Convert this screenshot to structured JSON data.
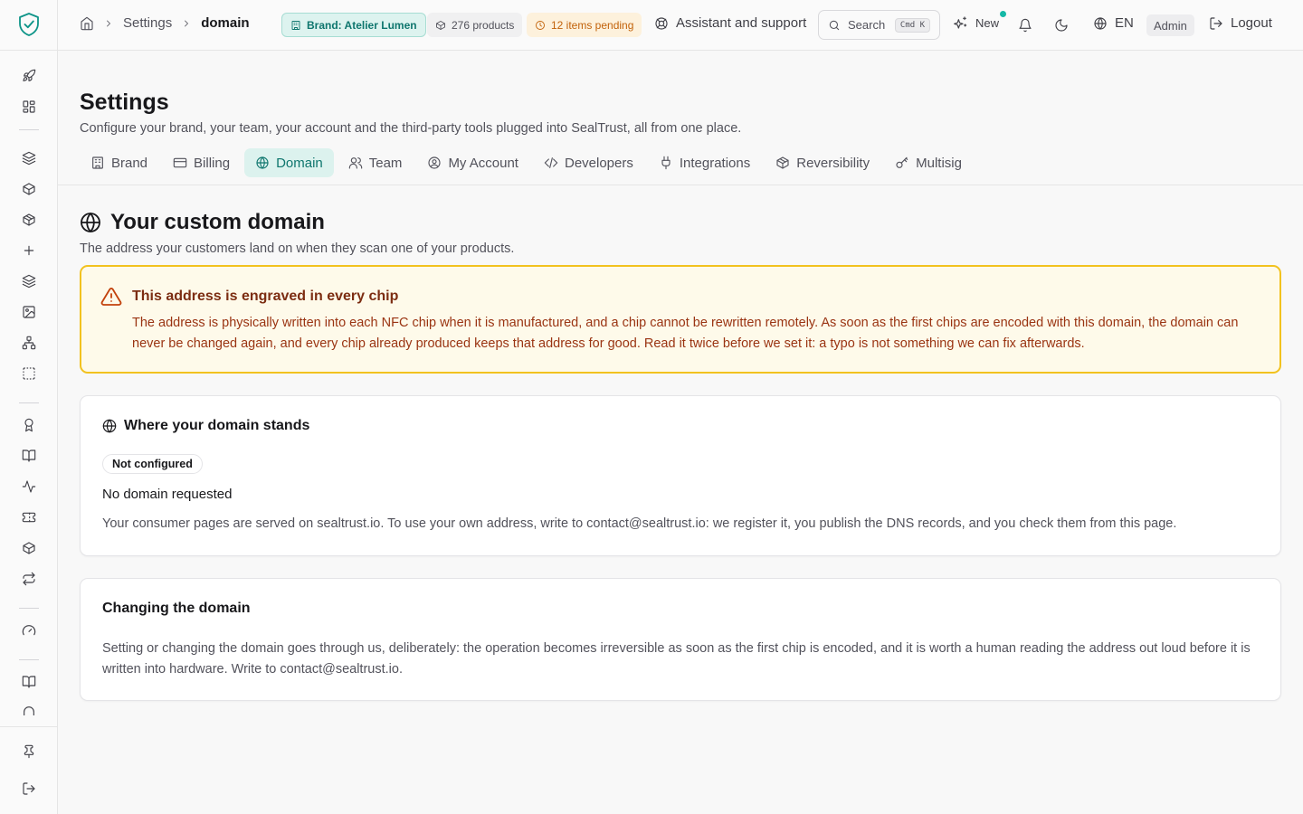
{
  "breadcrumb": {
    "parent": "Settings",
    "current": "domain"
  },
  "pills": {
    "brand": "Brand: Atelier Lumen",
    "products": "276 products",
    "pending": "12 items pending"
  },
  "topbar": {
    "assistant": "Assistant and support",
    "search_label": "Search",
    "search_shortcut": "Cmd  K",
    "new_label": "New",
    "language": "EN",
    "role": "Admin",
    "logout": "Logout"
  },
  "header": {
    "title": "Settings",
    "subtitle": "Configure your brand, your team, your account and the third-party tools plugged into SealTrust, all from one place."
  },
  "tabs": [
    {
      "label": "Brand",
      "icon": "building-icon"
    },
    {
      "label": "Billing",
      "icon": "credit-card-icon"
    },
    {
      "label": "Domain",
      "icon": "globe-icon",
      "active": true
    },
    {
      "label": "Team",
      "icon": "users-icon"
    },
    {
      "label": "My Account",
      "icon": "user-circle-icon"
    },
    {
      "label": "Developers",
      "icon": "code-icon"
    },
    {
      "label": "Integrations",
      "icon": "plug-icon"
    },
    {
      "label": "Reversibility",
      "icon": "package-icon"
    },
    {
      "label": "Multisig",
      "icon": "key-icon"
    }
  ],
  "section": {
    "title": "Your custom domain",
    "subtitle": "The address your customers land on when they scan one of your products."
  },
  "warning": {
    "title": "This address is engraved in every chip",
    "body": "The address is physically written into each NFC chip when it is manufactured, and a chip cannot be rewritten remotely. As soon as the first chips are encoded with this domain, the domain can never be changed again, and every chip already produced keeps that address for good. Read it twice before we set it: a typo is not something we can fix afterwards."
  },
  "status_card": {
    "title": "Where your domain stands",
    "badge": "Not configured",
    "headline": "No domain requested",
    "description": "Your consumer pages are served on sealtrust.io. To use your own address, write to contact@sealtrust.io: we register it, you publish the DNS records, and you check them from this page."
  },
  "change_card": {
    "title": "Changing the domain",
    "body": "Setting or changing the domain goes through us, deliberately: the operation becomes irreversible as soon as the first chip is encoded, and it is worth a human reading the address out loud before it is written into hardware. Write to contact@sealtrust.io."
  },
  "colors": {
    "accent": "#0f766e",
    "accent_bg": "#dcf2ee",
    "warning_border": "#f2c21f",
    "warning_bg": "#fefaea",
    "pending": "#c2620a"
  }
}
